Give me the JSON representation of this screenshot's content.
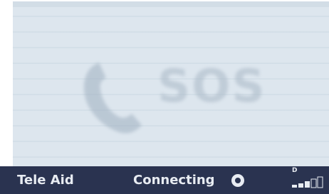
{
  "screen": {
    "watermark_text": "SOS",
    "watermark_icon": "phone-icon"
  },
  "status_bar": {
    "app_name": "Tele Aid",
    "status_text": "Connecting",
    "status_icon": "record-icon",
    "network_label": "D",
    "signal_icon": "signal-strength-icon",
    "signal_level": 0.5
  },
  "colors": {
    "status_bar_bg": "#2a3350",
    "status_text": "#e8ecf2",
    "screen_bg": "#dde6ee"
  }
}
